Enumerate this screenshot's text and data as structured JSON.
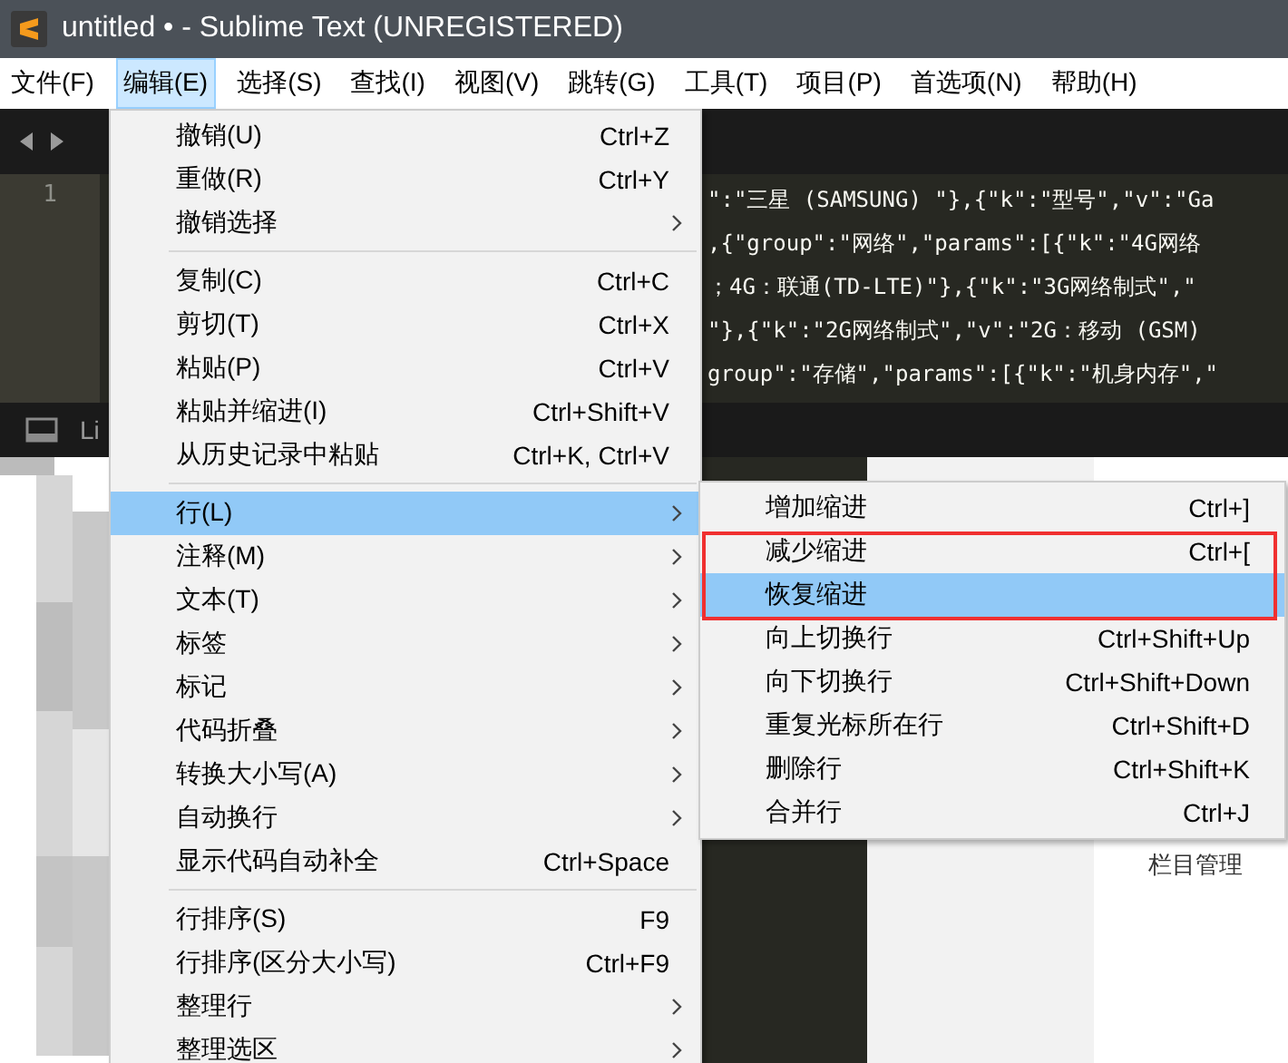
{
  "window": {
    "title": "untitled • - Sublime Text (UNREGISTERED)"
  },
  "menubar": [
    {
      "label": "文件(F)",
      "selected": false
    },
    {
      "label": "编辑(E)",
      "selected": true
    },
    {
      "label": "选择(S)",
      "selected": false
    },
    {
      "label": "查找(I)",
      "selected": false
    },
    {
      "label": "视图(V)",
      "selected": false
    },
    {
      "label": "跳转(G)",
      "selected": false
    },
    {
      "label": "工具(T)",
      "selected": false
    },
    {
      "label": "项目(P)",
      "selected": false
    },
    {
      "label": "首选项(N)",
      "selected": false
    },
    {
      "label": "帮助(H)",
      "selected": false
    }
  ],
  "editor": {
    "line_numbers": [
      "1"
    ],
    "code_lines": [
      "\":\"三星 (SAMSUNG) \"},{\"k\":\"型号\",\"v\":\"Ga",
      ",{\"group\":\"网络\",\"params\":[{\"k\":\"4G网络",
      "；4G：联通(TD-LTE)\"},{\"k\":\"3G网络制式\",\"",
      "\"},{\"k\":\"2G网络制式\",\"v\":\"2G：移动 (GSM)",
      "group\":\"存储\",\"params\":[{\"k\":\"机身内存\",\""
    ],
    "status_text": "Li"
  },
  "background_text": "栏目管理",
  "edit_menu": {
    "items": [
      {
        "kind": "item",
        "label": "撤销(U)",
        "shortcut": "Ctrl+Z",
        "submenu": false,
        "selected": false
      },
      {
        "kind": "item",
        "label": "重做(R)",
        "shortcut": "Ctrl+Y",
        "submenu": false,
        "selected": false
      },
      {
        "kind": "item",
        "label": "撤销选择",
        "submenu": true,
        "selected": false
      },
      {
        "kind": "separator"
      },
      {
        "kind": "item",
        "label": "复制(C)",
        "shortcut": "Ctrl+C",
        "submenu": false,
        "selected": false
      },
      {
        "kind": "item",
        "label": "剪切(T)",
        "shortcut": "Ctrl+X",
        "submenu": false,
        "selected": false
      },
      {
        "kind": "item",
        "label": "粘贴(P)",
        "shortcut": "Ctrl+V",
        "submenu": false,
        "selected": false
      },
      {
        "kind": "item",
        "label": "粘贴并缩进(I)",
        "shortcut": "Ctrl+Shift+V",
        "submenu": false,
        "selected": false
      },
      {
        "kind": "item",
        "label": "从历史记录中粘贴",
        "shortcut": "Ctrl+K, Ctrl+V",
        "submenu": false,
        "selected": false
      },
      {
        "kind": "separator"
      },
      {
        "kind": "item",
        "label": "行(L)",
        "submenu": true,
        "selected": true
      },
      {
        "kind": "item",
        "label": "注释(M)",
        "submenu": true,
        "selected": false
      },
      {
        "kind": "item",
        "label": "文本(T)",
        "submenu": true,
        "selected": false
      },
      {
        "kind": "item",
        "label": "标签",
        "submenu": true,
        "selected": false
      },
      {
        "kind": "item",
        "label": "标记",
        "submenu": true,
        "selected": false
      },
      {
        "kind": "item",
        "label": "代码折叠",
        "submenu": true,
        "selected": false
      },
      {
        "kind": "item",
        "label": "转换大小写(A)",
        "submenu": true,
        "selected": false
      },
      {
        "kind": "item",
        "label": "自动换行",
        "submenu": true,
        "selected": false
      },
      {
        "kind": "item",
        "label": "显示代码自动补全",
        "shortcut": "Ctrl+Space",
        "submenu": false,
        "selected": false
      },
      {
        "kind": "separator"
      },
      {
        "kind": "item",
        "label": "行排序(S)",
        "shortcut": "F9",
        "submenu": false,
        "selected": false
      },
      {
        "kind": "item",
        "label": "行排序(区分大小写)",
        "shortcut": "Ctrl+F9",
        "submenu": false,
        "selected": false
      },
      {
        "kind": "item",
        "label": "整理行",
        "submenu": true,
        "selected": false
      },
      {
        "kind": "item",
        "label": "整理选区",
        "submenu": true,
        "selected": false
      }
    ]
  },
  "line_submenu": {
    "items": [
      {
        "kind": "item",
        "label": "增加缩进",
        "shortcut": "Ctrl+]",
        "submenu": false,
        "selected": false
      },
      {
        "kind": "item",
        "label": "减少缩进",
        "shortcut": "Ctrl+[",
        "submenu": false,
        "selected": false
      },
      {
        "kind": "item",
        "label": "恢复缩进",
        "submenu": false,
        "selected": true
      },
      {
        "kind": "item",
        "label": "向上切换行",
        "shortcut": "Ctrl+Shift+Up",
        "submenu": false,
        "selected": false
      },
      {
        "kind": "item",
        "label": "向下切换行",
        "shortcut": "Ctrl+Shift+Down",
        "submenu": false,
        "selected": false
      },
      {
        "kind": "item",
        "label": "重复光标所在行",
        "shortcut": "Ctrl+Shift+D",
        "submenu": false,
        "selected": false
      },
      {
        "kind": "item",
        "label": "删除行",
        "shortcut": "Ctrl+Shift+K",
        "submenu": false,
        "selected": false
      },
      {
        "kind": "item",
        "label": "合并行",
        "shortcut": "Ctrl+J",
        "submenu": false,
        "selected": false
      }
    ]
  }
}
